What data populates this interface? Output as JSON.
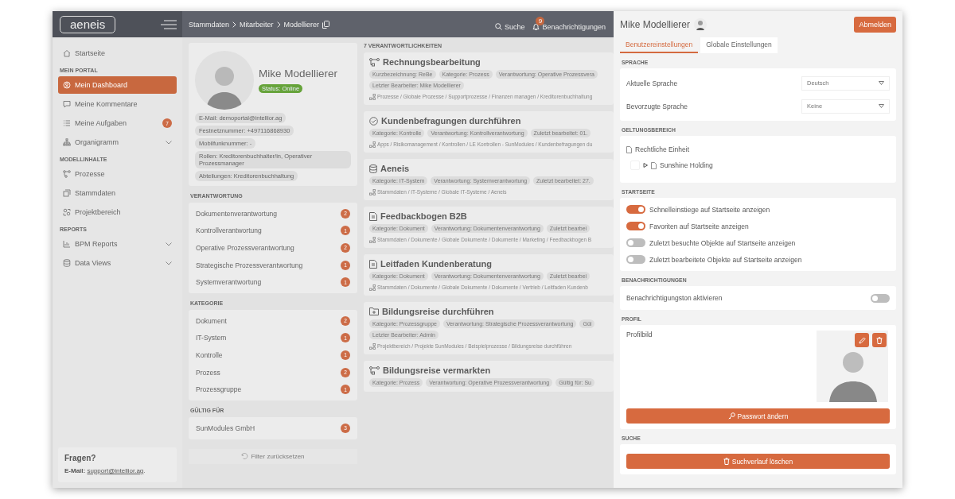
{
  "topbar": {
    "logo": "aeneis",
    "breadcrumb": [
      "Stammdaten",
      "Mitarbeiter",
      "Modellierer"
    ],
    "search_label": "Suche",
    "notifications_label": "Benachrichtigungen",
    "notifications_count": "9"
  },
  "sidebar": {
    "items": [
      {
        "kind": "link",
        "label": "Startseite",
        "selected": false,
        "expandable": false
      },
      {
        "kind": "heading",
        "label": "MEIN PORTAL"
      },
      {
        "kind": "link",
        "label": "Mein Dashboard",
        "selected": true,
        "expandable": false
      },
      {
        "kind": "link",
        "label": "Meine Kommentare",
        "selected": false,
        "expandable": false
      },
      {
        "kind": "link",
        "label": "Meine Aufgaben",
        "selected": false,
        "expandable": false,
        "badge": "7"
      },
      {
        "kind": "link",
        "label": "Organigramm",
        "selected": false,
        "expandable": true
      },
      {
        "kind": "heading",
        "label": "MODELLINHALTE"
      },
      {
        "kind": "link",
        "label": "Prozesse",
        "selected": false,
        "expandable": false
      },
      {
        "kind": "link",
        "label": "Stammdaten",
        "selected": false,
        "expandable": false
      },
      {
        "kind": "link",
        "label": "Projektbereich",
        "selected": false,
        "expandable": false
      },
      {
        "kind": "heading",
        "label": "REPORTS"
      },
      {
        "kind": "link",
        "label": "BPM Reports",
        "selected": false,
        "expandable": true
      },
      {
        "kind": "link",
        "label": "Data Views",
        "selected": false,
        "expandable": true
      }
    ],
    "help": {
      "title": "Fragen?",
      "email_label": "E-Mail:",
      "email": "support@intellior.ag",
      "suffix": "."
    }
  },
  "profile": {
    "name": "Mike Modellierer",
    "status": "Status: Online",
    "details": [
      "E-Mail: demoportal@intellior.ag",
      "Festnetznummer: +497116868930",
      "Mobilfunknummer: -",
      "Rollen: Kreditorenbuchhalter/in, Operativer Prozessmanager",
      "Abteilungen: Kreditorenbuchhaltung"
    ]
  },
  "filters": [
    {
      "title": "VERANTWORTUNG",
      "items": [
        {
          "label": "Dokumentenverantwortung",
          "count": "2"
        },
        {
          "label": "Kontrollverantwortung",
          "count": "1"
        },
        {
          "label": "Operative Prozessverantwortung",
          "count": "2"
        },
        {
          "label": "Strategische Prozessverantwortung",
          "count": "1"
        },
        {
          "label": "Systemverantwortung",
          "count": "1"
        }
      ]
    },
    {
      "title": "KATEGORIE",
      "items": [
        {
          "label": "Dokument",
          "count": "2"
        },
        {
          "label": "IT-System",
          "count": "1"
        },
        {
          "label": "Kontrolle",
          "count": "1"
        },
        {
          "label": "Prozess",
          "count": "2"
        },
        {
          "label": "Prozessgruppe",
          "count": "1"
        }
      ]
    },
    {
      "title": "GÜLTIG FÜR",
      "items": [
        {
          "label": "SunModules GmbH",
          "count": "3"
        }
      ]
    }
  ],
  "filter_reset": {
    "label": "Filter zurücksetzen",
    "disabled": true
  },
  "results": {
    "heading": "7 VERANTWORTLICHKEITEN",
    "cards": [
      {
        "kind": "process",
        "title": "Rechnungsbearbeitung",
        "tags": [
          "Kurzbezeichnung: ReBe",
          "Kategorie: Prozess",
          "Verantwortung: Operative Prozessvera",
          "Letzter Bearbeiter: Mike Modellierer"
        ],
        "path": "Prozesse / Globale Prozesse / Supportprozesse / Finanzen managen / Kreditorenbuchhaltung"
      },
      {
        "kind": "control",
        "title": "Kundenbefragungen durchführen",
        "tags": [
          "Kategorie: Kontrolle",
          "Verantwortung: Kontrollverantwortung",
          "Zuletzt bearbeitet: 01."
        ],
        "path": "Apps / Risikomanagement / Kontrollen / LE Kontrollen - SunModules / Kundenbefragungen du"
      },
      {
        "kind": "system",
        "title": "Aeneis",
        "tags": [
          "Kategorie: IT-System",
          "Verantwortung: Systemverantwortung",
          "Zuletzt bearbeitet: 27."
        ],
        "path": "Stammdaten / IT-Systeme / Globale IT-Systeme / Aeneis"
      },
      {
        "kind": "document",
        "title": "Feedbackbogen B2B",
        "tags": [
          "Kategorie: Dokument",
          "Verantwortung: Dokumentenverantwortung",
          "Zuletzt bearbei"
        ],
        "path": "Stammdaten / Dokumente / Globale Dokumente / Dokumente / Marketing / Feedbackbogen B"
      },
      {
        "kind": "document",
        "title": "Leitfaden Kundenberatung",
        "tags": [
          "Kategorie: Dokument",
          "Verantwortung: Dokumentenverantwortung",
          "Zuletzt bearbei"
        ],
        "path": "Stammdaten / Dokumente / Globale Dokumente / Dokumente / Vertrieb / Leitfaden Kundenb"
      },
      {
        "kind": "group",
        "title": "Bildungsreise durchführen",
        "tags": [
          "Kategorie: Prozessgruppe",
          "Verantwortung: Strategische Prozessverantwortung",
          "Gül",
          "Letzter Bearbeiter: Admin"
        ],
        "path": "Projektbereich / Projekte SunModules / Beispielprozesse / Bildungsreise durchführen"
      },
      {
        "kind": "process",
        "title": "Bildungsreise vermarkten",
        "tags": [
          "Kategorie: Prozess",
          "Verantwortung: Operative Prozessverantwortung",
          "Gültig für: Su"
        ]
      }
    ]
  },
  "drawer": {
    "user_name": "Mike Modellierer",
    "logout": "Abmelden",
    "tabs": [
      {
        "label": "Benutzereinstellungen",
        "selected": true
      },
      {
        "label": "Globale Einstellungen",
        "selected": false
      }
    ],
    "sections": [
      {
        "kind": "selects",
        "title": "SPRACHE",
        "rows": [
          {
            "label": "Aktuelle Sprache",
            "value": "Deutsch"
          },
          {
            "label": "Bevorzugte Sprache",
            "value": "Keine"
          }
        ]
      },
      {
        "kind": "tree",
        "title": "GELTUNGSBEREICH",
        "tree": [
          {
            "label": "Rechtliche Einheit",
            "children": [
              {
                "label": "Sunshine Holding",
                "checked": false,
                "expanded": false
              }
            ]
          }
        ]
      },
      {
        "kind": "toggles_left",
        "title": "STARTSEITE",
        "rows": [
          {
            "label": "Schnelleinstiege auf Startseite anzeigen",
            "on": true
          },
          {
            "label": "Favoriten auf Startseite anzeigen",
            "on": true
          },
          {
            "label": "Zuletzt besuchte Objekte auf Startseite anzeigen",
            "on": false
          },
          {
            "label": "Zuletzt bearbeitete Objekte auf Startseite anzeigen",
            "on": false
          }
        ]
      },
      {
        "kind": "toggles_right",
        "title": "BENACHRICHTIGUNGEN",
        "rows": [
          {
            "label": "Benachrichtigungston aktivieren",
            "on": false
          }
        ]
      },
      {
        "kind": "profile",
        "title": "PROFIL",
        "label": "Profilbild",
        "button": "Passwort ändern"
      },
      {
        "kind": "action",
        "title": "SUCHE",
        "button": "Suchverlauf löschen"
      }
    ]
  }
}
